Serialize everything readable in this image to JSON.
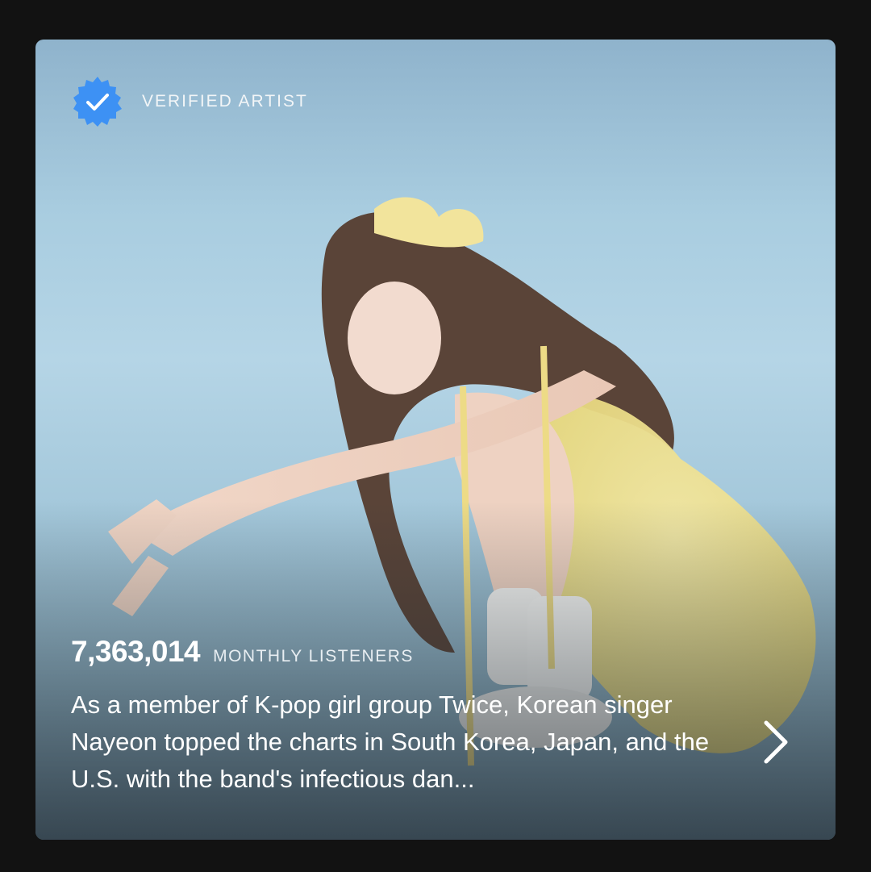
{
  "artist_card": {
    "verified_label": "VERIFIED ARTIST",
    "monthly_listeners": "7,363,014",
    "monthly_listeners_label": "MONTHLY LISTENERS",
    "bio": "As a member of K-pop girl group Twice, Korean singer Nayeon topped the charts in South Korea, Japan, and the U.S. with the band's infectious dan...",
    "icons": {
      "verified": "verified-badge-icon",
      "open": "chevron-right-icon"
    },
    "colors": {
      "page_background": "#121212",
      "verified_badge": "#3d91f4",
      "text": "#ffffff"
    }
  }
}
